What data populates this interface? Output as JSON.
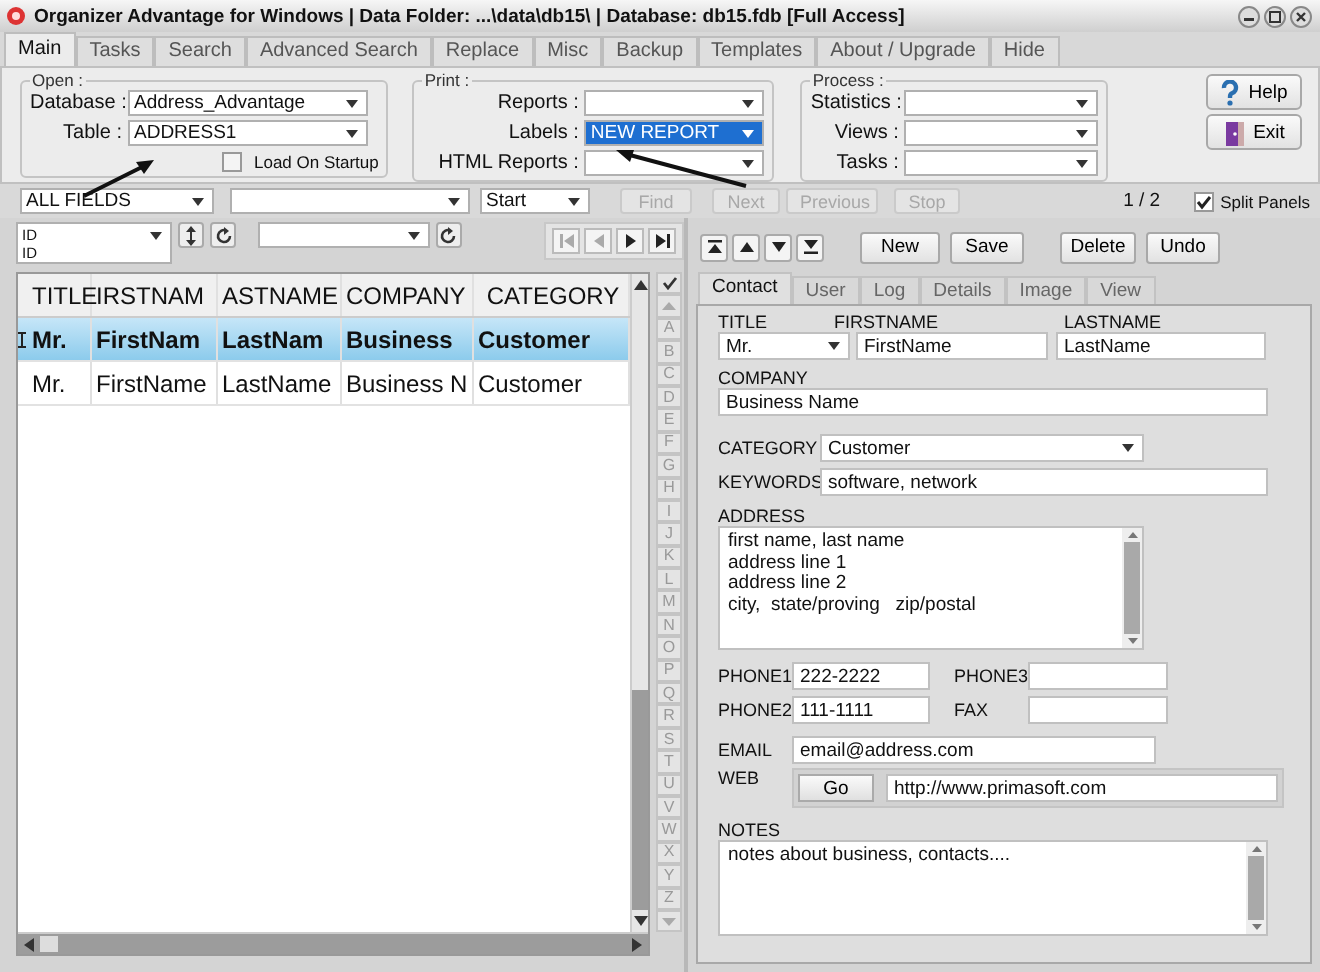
{
  "window": {
    "title": "Organizer Advantage for Windows | Data Folder: ...\\data\\db15\\ | Database: db15.fdb [Full Access]"
  },
  "tabs": [
    {
      "label": "Main",
      "selected": true
    },
    {
      "label": "Tasks",
      "selected": false
    },
    {
      "label": "Search",
      "selected": false
    },
    {
      "label": "Advanced Search",
      "selected": false
    },
    {
      "label": "Replace",
      "selected": false
    },
    {
      "label": "Misc",
      "selected": false
    },
    {
      "label": "Backup",
      "selected": false
    },
    {
      "label": "Templates",
      "selected": false
    },
    {
      "label": "About / Upgrade",
      "selected": false
    },
    {
      "label": "Hide",
      "selected": false
    }
  ],
  "open_group": {
    "legend": "Open :",
    "fields": [
      {
        "label": "Database :",
        "value": "Address_Advantage"
      },
      {
        "label": "Table :",
        "value": "ADDRESS1"
      }
    ],
    "load_on_startup": {
      "label": "Load On Startup",
      "checked": false
    }
  },
  "print_group": {
    "legend": "Print :",
    "fields": [
      {
        "label": "Reports :",
        "highlighted": false
      },
      {
        "label": "Labels :",
        "value": "NEW REPORT",
        "highlighted": true
      },
      {
        "label": "HTML Reports :",
        "highlighted": false
      }
    ]
  },
  "process_group": {
    "legend": "Process :",
    "fields": [
      {
        "label": "Statistics :"
      },
      {
        "label": "Views :"
      },
      {
        "label": "Tasks :"
      }
    ]
  },
  "side_buttons": [
    {
      "label": "Help",
      "kind": "help"
    },
    {
      "label": "Exit",
      "kind": "exit"
    }
  ],
  "search_bar": {
    "field": "ALL FIELDS",
    "mode": "Start",
    "buttons": [
      {
        "label": "Find",
        "disabled": true
      },
      {
        "label": "Next",
        "disabled": true
      },
      {
        "label": "Previous",
        "disabled": true
      },
      {
        "label": "Stop",
        "disabled": true
      }
    ],
    "page": "1 / 2",
    "split_panels": {
      "label": "Split Panels",
      "checked": true
    }
  },
  "grid_toolbar": {
    "sort_field": "ID",
    "sort_caption": "ID"
  },
  "grid": {
    "columns": [
      "TITLE",
      "IRSTNAM",
      "ASTNAME",
      "COMPANY",
      "CATEGORY"
    ],
    "rows": [
      {
        "cells": [
          "Mr.",
          "FirstNam",
          "LastNam",
          "Business",
          "Customer"
        ],
        "selected": true
      },
      {
        "cells": [
          "Mr.",
          "FirstName",
          "LastName",
          "Business N",
          "Customer"
        ],
        "selected": false
      }
    ]
  },
  "alphabet": [
    "A",
    "B",
    "C",
    "D",
    "E",
    "F",
    "G",
    "H",
    "I",
    "J",
    "K",
    "L",
    "M",
    "N",
    "O",
    "P",
    "Q",
    "R",
    "S",
    "T",
    "U",
    "V",
    "W",
    "X",
    "Y",
    "Z"
  ],
  "record_buttons": [
    "New",
    "Save",
    "Delete",
    "Undo"
  ],
  "record_tabs": [
    {
      "label": "Contact",
      "selected": true
    },
    {
      "label": "User",
      "selected": false
    },
    {
      "label": "Log",
      "selected": false
    },
    {
      "label": "Details",
      "selected": false
    },
    {
      "label": "Image",
      "selected": false
    },
    {
      "label": "View",
      "selected": false
    }
  ],
  "form": {
    "title": {
      "label": "TITLE",
      "value": "Mr."
    },
    "firstname": {
      "label": "FIRSTNAME",
      "value": "FirstName"
    },
    "lastname": {
      "label": "LASTNAME",
      "value": "LastName"
    },
    "company": {
      "label": "COMPANY",
      "value": "Business Name"
    },
    "category": {
      "label": "CATEGORY",
      "value": "Customer"
    },
    "keywords": {
      "label": "KEYWORDS",
      "value": "software, network"
    },
    "address": {
      "label": "ADDRESS",
      "lines": [
        "first name, last name",
        "address line 1",
        "address line 2",
        "city,  state/proving   zip/postal"
      ]
    },
    "phone1": {
      "label": "PHONE1",
      "value": "222-2222"
    },
    "phone3": {
      "label": "PHONE3"
    },
    "phone2": {
      "label": "PHONE2",
      "value": "111-1111"
    },
    "fax": {
      "label": "FAX"
    },
    "email": {
      "label": "EMAIL",
      "value": "email@address.com"
    },
    "web": {
      "label": "WEB",
      "button": "Go",
      "value": "http://www.primasoft.com"
    },
    "notes": {
      "label": "NOTES",
      "value": "notes about business, contacts...."
    }
  }
}
